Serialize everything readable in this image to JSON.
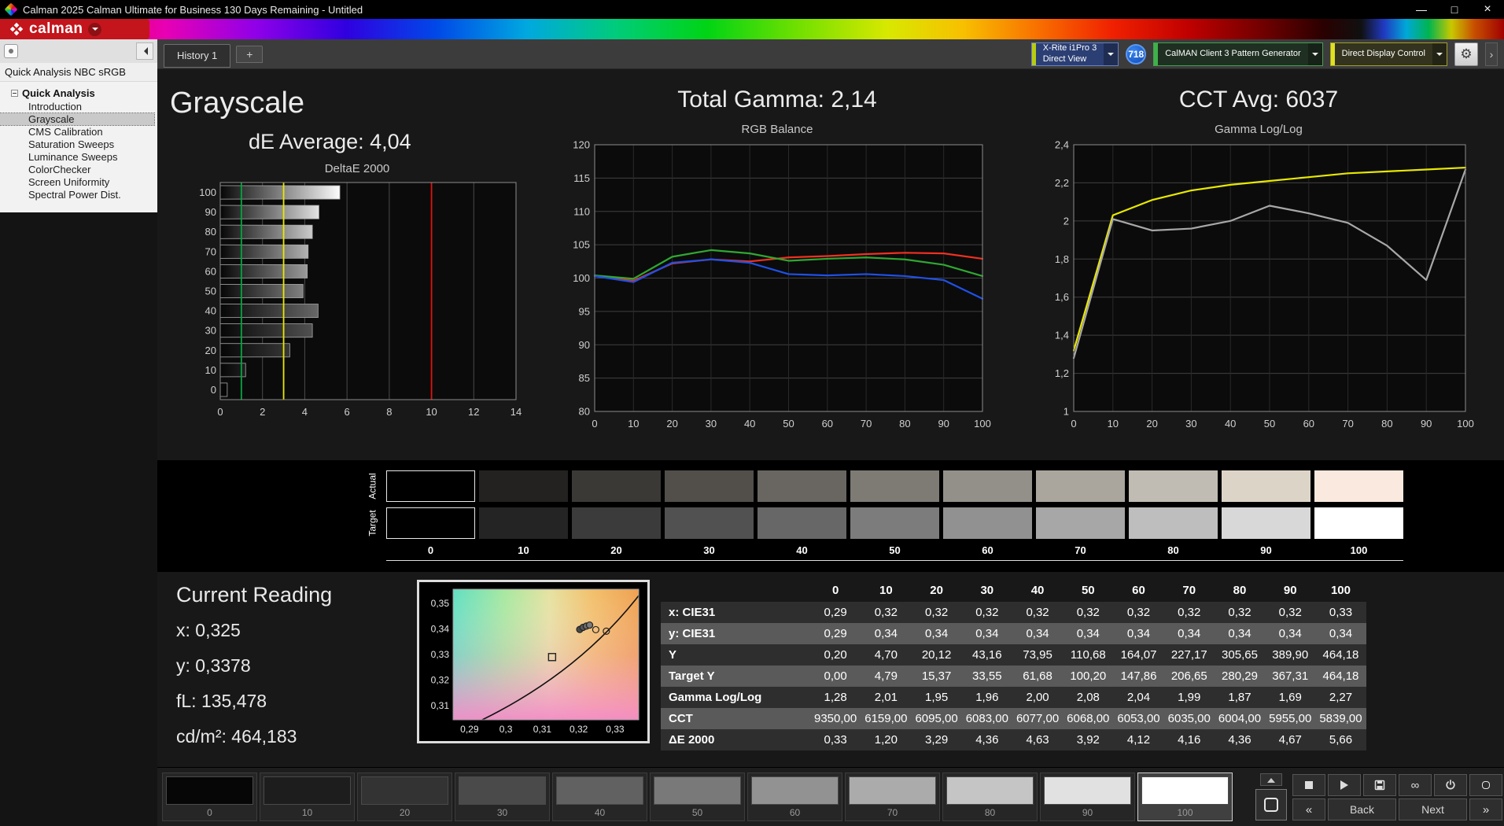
{
  "titlebar": {
    "title": "Calman 2025 Calman Ultimate for Business 130 Days Remaining  - Untitled",
    "minimize": "—",
    "maximize": "□",
    "close": "×"
  },
  "logo": {
    "brand": "calman"
  },
  "tabs": {
    "history": "History 1",
    "add": "+"
  },
  "toolbar": {
    "meter_line1": "X-Rite i1Pro 3",
    "meter_line2": "Direct View",
    "badge": "718",
    "pattern_generator": "CalMAN Client 3 Pattern Generator",
    "display_control": "Direct Display Control",
    "gear_icon": "⚙",
    "more_icon": "›"
  },
  "sidebar": {
    "caption": "Quick Analysis NBC sRGB",
    "root": "Quick Analysis",
    "items": [
      {
        "label": "Introduction",
        "selected": false
      },
      {
        "label": "Grayscale",
        "selected": true
      },
      {
        "label": "CMS Calibration",
        "selected": false
      },
      {
        "label": "Saturation Sweeps",
        "selected": false
      },
      {
        "label": "Luminance Sweeps",
        "selected": false
      },
      {
        "label": "ColorChecker",
        "selected": false
      },
      {
        "label": "Screen Uniformity",
        "selected": false
      },
      {
        "label": "Spectral Power Dist.",
        "selected": false
      }
    ]
  },
  "panels": {
    "grayscale_title": "Grayscale",
    "de_average": "dE Average: 4,04",
    "gamma_title": "Total Gamma: 2,14",
    "cct_title": "CCT Avg: 6037"
  },
  "current_reading": {
    "title": "Current Reading",
    "x": "x: 0,325",
    "y": "y: 0,3378",
    "fl": "fL: 135,478",
    "cd": "cd/m²: 464,183"
  },
  "swatches": {
    "row_labels": [
      "Actual",
      "Target"
    ],
    "labels": [
      "0",
      "10",
      "20",
      "30",
      "40",
      "50",
      "60",
      "70",
      "80",
      "90",
      "100"
    ],
    "actual_colors": [
      "#000000",
      "#232220",
      "#3a3936",
      "#524f4b",
      "#696661",
      "#7e7b75",
      "#939089",
      "#aaa69e",
      "#c1bcb3",
      "#ddd4c8",
      "#f9e9de"
    ],
    "target_colors": [
      "#000000",
      "#242424",
      "#3b3b3b",
      "#515151",
      "#676767",
      "#7c7c7c",
      "#919191",
      "#a7a7a7",
      "#bebebe",
      "#d8d8d8",
      "#ffffff"
    ]
  },
  "table": {
    "columns": [
      "0",
      "10",
      "20",
      "30",
      "40",
      "50",
      "60",
      "70",
      "80",
      "90",
      "100"
    ],
    "rows": [
      {
        "label": "x: CIE31",
        "values": [
          "0,29",
          "0,32",
          "0,32",
          "0,32",
          "0,32",
          "0,32",
          "0,32",
          "0,32",
          "0,32",
          "0,32",
          "0,33"
        ]
      },
      {
        "label": "y: CIE31",
        "values": [
          "0,29",
          "0,34",
          "0,34",
          "0,34",
          "0,34",
          "0,34",
          "0,34",
          "0,34",
          "0,34",
          "0,34",
          "0,34"
        ]
      },
      {
        "label": "Y",
        "values": [
          "0,20",
          "4,70",
          "20,12",
          "43,16",
          "73,95",
          "110,68",
          "164,07",
          "227,17",
          "305,65",
          "389,90",
          "464,18"
        ]
      },
      {
        "label": "Target Y",
        "values": [
          "0,00",
          "4,79",
          "15,37",
          "33,55",
          "61,68",
          "100,20",
          "147,86",
          "206,65",
          "280,29",
          "367,31",
          "464,18"
        ]
      },
      {
        "label": "Gamma Log/Log",
        "values": [
          "1,28",
          "2,01",
          "1,95",
          "1,96",
          "2,00",
          "2,08",
          "2,04",
          "1,99",
          "1,87",
          "1,69",
          "2,27"
        ]
      },
      {
        "label": "CCT",
        "values": [
          "9350,00",
          "6159,00",
          "6095,00",
          "6083,00",
          "6077,00",
          "6068,00",
          "6053,00",
          "6035,00",
          "6004,00",
          "5955,00",
          "5839,00"
        ]
      },
      {
        "label": "ΔE 2000",
        "values": [
          "0,33",
          "1,20",
          "3,29",
          "4,36",
          "4,63",
          "3,92",
          "4,12",
          "4,16",
          "4,36",
          "4,67",
          "5,66"
        ]
      }
    ]
  },
  "bottom_bar": {
    "patches": [
      {
        "label": "0",
        "color": "#060606",
        "selected": false
      },
      {
        "label": "10",
        "color": "#1d1d1d",
        "selected": false
      },
      {
        "label": "20",
        "color": "#333333",
        "selected": false
      },
      {
        "label": "30",
        "color": "#4a4a4a",
        "selected": false
      },
      {
        "label": "40",
        "color": "#616161",
        "selected": false
      },
      {
        "label": "50",
        "color": "#797979",
        "selected": false
      },
      {
        "label": "60",
        "color": "#929292",
        "selected": false
      },
      {
        "label": "70",
        "color": "#ababab",
        "selected": false
      },
      {
        "label": "80",
        "color": "#c5c5c5",
        "selected": false
      },
      {
        "label": "90",
        "color": "#e1e1e1",
        "selected": false
      },
      {
        "label": "100",
        "color": "#ffffff",
        "selected": true
      }
    ],
    "back_label": "Back",
    "next_label": "Next",
    "prev_icon": "«",
    "next_icon": "»",
    "infinity_icon": "∞"
  },
  "chart_data": [
    {
      "id": "deltae",
      "type": "bar",
      "orientation": "horizontal",
      "title": "DeltaE 2000",
      "categories": [
        100,
        90,
        80,
        70,
        60,
        50,
        40,
        30,
        20,
        10,
        0
      ],
      "values": [
        5.66,
        4.67,
        4.36,
        4.16,
        4.12,
        3.92,
        4.63,
        4.36,
        3.29,
        1.2,
        0.33
      ],
      "xlim": [
        0,
        14
      ],
      "xticks": [
        0,
        2,
        4,
        6,
        8,
        10,
        12,
        14
      ],
      "reference_lines": [
        {
          "x": 1,
          "color": "#00a83c"
        },
        {
          "x": 3,
          "color": "#e8e800"
        },
        {
          "x": 10,
          "color": "#e01010"
        }
      ]
    },
    {
      "id": "rgb",
      "type": "line",
      "title": "RGB Balance",
      "x": [
        0,
        10,
        20,
        30,
        40,
        50,
        60,
        70,
        80,
        90,
        100
      ],
      "ylim": [
        80,
        120
      ],
      "yticks": [
        80,
        85,
        90,
        95,
        100,
        105,
        110,
        115,
        120
      ],
      "series": [
        {
          "name": "Red",
          "color": "#f03020",
          "values": [
            100.3,
            99.6,
            102.2,
            102.8,
            102.5,
            103.1,
            103.3,
            103.6,
            103.8,
            103.7,
            102.9
          ]
        },
        {
          "name": "Green",
          "color": "#2fa832",
          "values": [
            100.4,
            99.9,
            103.2,
            104.2,
            103.7,
            102.6,
            102.9,
            103.1,
            102.8,
            102.0,
            100.3
          ]
        },
        {
          "name": "Blue",
          "color": "#2050e8",
          "values": [
            100.3,
            99.4,
            102.3,
            102.8,
            102.3,
            100.6,
            100.4,
            100.6,
            100.3,
            99.7,
            96.9
          ]
        }
      ]
    },
    {
      "id": "gamma",
      "type": "line",
      "title": "Gamma Log/Log",
      "x": [
        0,
        10,
        20,
        30,
        40,
        50,
        60,
        70,
        80,
        90,
        100
      ],
      "ylim": [
        1,
        2.4
      ],
      "yticks": [
        1,
        1.2,
        1.4,
        1.6,
        1.8,
        2,
        2.2,
        2.4
      ],
      "ytick_labels": [
        "1",
        "1,2",
        "1,4",
        "1,6",
        "1,8",
        "2",
        "2,2",
        "2,4"
      ],
      "series": [
        {
          "name": "Target",
          "color": "#e8e800",
          "values": [
            1.32,
            2.03,
            2.11,
            2.16,
            2.19,
            2.21,
            2.23,
            2.25,
            2.26,
            2.27,
            2.28
          ]
        },
        {
          "name": "Measured",
          "color": "#a8a8a8",
          "values": [
            1.28,
            2.01,
            1.95,
            1.96,
            2.0,
            2.08,
            2.04,
            1.99,
            1.87,
            1.69,
            2.27
          ]
        }
      ]
    },
    {
      "id": "cie",
      "type": "scatter",
      "title": "CIE 1931",
      "xlim": [
        0.2855,
        0.3365
      ],
      "ylim": [
        0.3045,
        0.3555
      ],
      "xtick_vals": [
        0.29,
        0.3,
        0.31,
        0.32,
        0.33
      ],
      "xticks": [
        "0,29",
        "0,3",
        "0,31",
        "0,32",
        "0,33"
      ],
      "ytick_vals": [
        0.31,
        0.32,
        0.33,
        0.34,
        0.35
      ],
      "yticks": [
        "0,31",
        "0,32",
        "0,33",
        "0,34",
        "0,35"
      ],
      "curve": [
        [
          0.2935,
          0.3045
        ],
        [
          0.32,
          0.323
        ],
        [
          0.3365,
          0.353
        ]
      ],
      "points": [
        {
          "x": 0.3127,
          "y": 0.329,
          "shape": "square"
        },
        {
          "x": 0.3203,
          "y": 0.3398,
          "shape": "circle",
          "fill": "#4a4a4a"
        },
        {
          "x": 0.3212,
          "y": 0.3406,
          "shape": "circle",
          "fill": "#585858"
        },
        {
          "x": 0.3221,
          "y": 0.3411,
          "shape": "circle",
          "fill": "#6a6a6a"
        },
        {
          "x": 0.323,
          "y": 0.3415,
          "shape": "circle",
          "fill": "#7c7c7c"
        },
        {
          "x": 0.3247,
          "y": 0.3397,
          "shape": "circle"
        },
        {
          "x": 0.3276,
          "y": 0.3391,
          "shape": "circle"
        }
      ]
    }
  ]
}
